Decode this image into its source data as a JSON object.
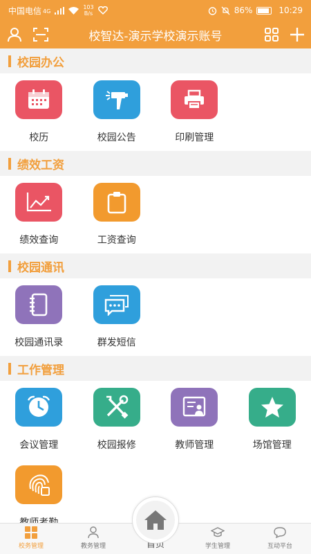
{
  "status_bar": {
    "carrier": "中国电信",
    "network": "4G",
    "speed_value": "103",
    "speed_unit": "B/s",
    "battery": "86%",
    "time": "10:29"
  },
  "app_bar": {
    "title": "校智达-演示学校演示账号"
  },
  "colors": {
    "accent": "#f29f3d",
    "red": "#ea5564",
    "blue": "#2f9fdc",
    "orange": "#f29a2e",
    "purple": "#8f73ba",
    "green": "#36ad8a"
  },
  "sections": [
    {
      "title": "校园办公",
      "items": [
        {
          "label": "校历",
          "icon": "calendar-icon"
        },
        {
          "label": "校园公告",
          "icon": "megaphone-icon"
        },
        {
          "label": "印刷管理",
          "icon": "printer-icon"
        }
      ]
    },
    {
      "title": "绩效工资",
      "items": [
        {
          "label": "绩效查询",
          "icon": "line-chart-icon"
        },
        {
          "label": "工资查询",
          "icon": "clipboard-icon"
        }
      ]
    },
    {
      "title": "校园通讯",
      "items": [
        {
          "label": "校园通讯录",
          "icon": "address-book-icon"
        },
        {
          "label": "群发短信",
          "icon": "message-icon"
        }
      ]
    },
    {
      "title": "工作管理",
      "items": [
        {
          "label": "会议管理",
          "icon": "clock-icon"
        },
        {
          "label": "校园报修",
          "icon": "tools-icon"
        },
        {
          "label": "教师管理",
          "icon": "teacher-board-icon"
        },
        {
          "label": "场馆管理",
          "icon": "star-icon"
        },
        {
          "label": "教师考勤",
          "icon": "fingerprint-icon"
        }
      ]
    }
  ],
  "bottom_nav": [
    {
      "label": "校务管理",
      "icon": "grid-icon"
    },
    {
      "label": "教务管理",
      "icon": "person-icon"
    },
    {
      "label": "首页",
      "icon": "home-icon"
    },
    {
      "label": "学生管理",
      "icon": "graduation-cap-icon"
    },
    {
      "label": "互动平台",
      "icon": "chat-bubble-icon"
    }
  ]
}
